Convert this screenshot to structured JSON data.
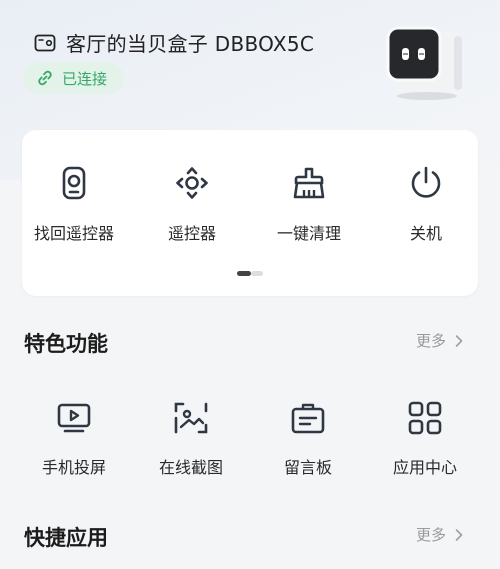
{
  "header": {
    "device_name": "客厅的当贝盒子 DBBOX5C",
    "status": "已连接",
    "status_color": "#35a867"
  },
  "quick_actions": [
    {
      "label": "找回遥控器",
      "icon": "remote-finder-icon"
    },
    {
      "label": "遥控器",
      "icon": "dpad-icon"
    },
    {
      "label": "一键清理",
      "icon": "broom-icon"
    },
    {
      "label": "关机",
      "icon": "power-icon"
    }
  ],
  "pager": {
    "pages": 2,
    "current": 1
  },
  "features": {
    "title": "特色功能",
    "more": "更多",
    "items": [
      {
        "label": "手机投屏",
        "icon": "screen-cast-icon"
      },
      {
        "label": "在线截图",
        "icon": "screenshot-icon"
      },
      {
        "label": "留言板",
        "icon": "message-board-icon"
      },
      {
        "label": "应用中心",
        "icon": "app-grid-icon"
      }
    ]
  },
  "shortcuts": {
    "title": "快捷应用",
    "more": "更多"
  }
}
